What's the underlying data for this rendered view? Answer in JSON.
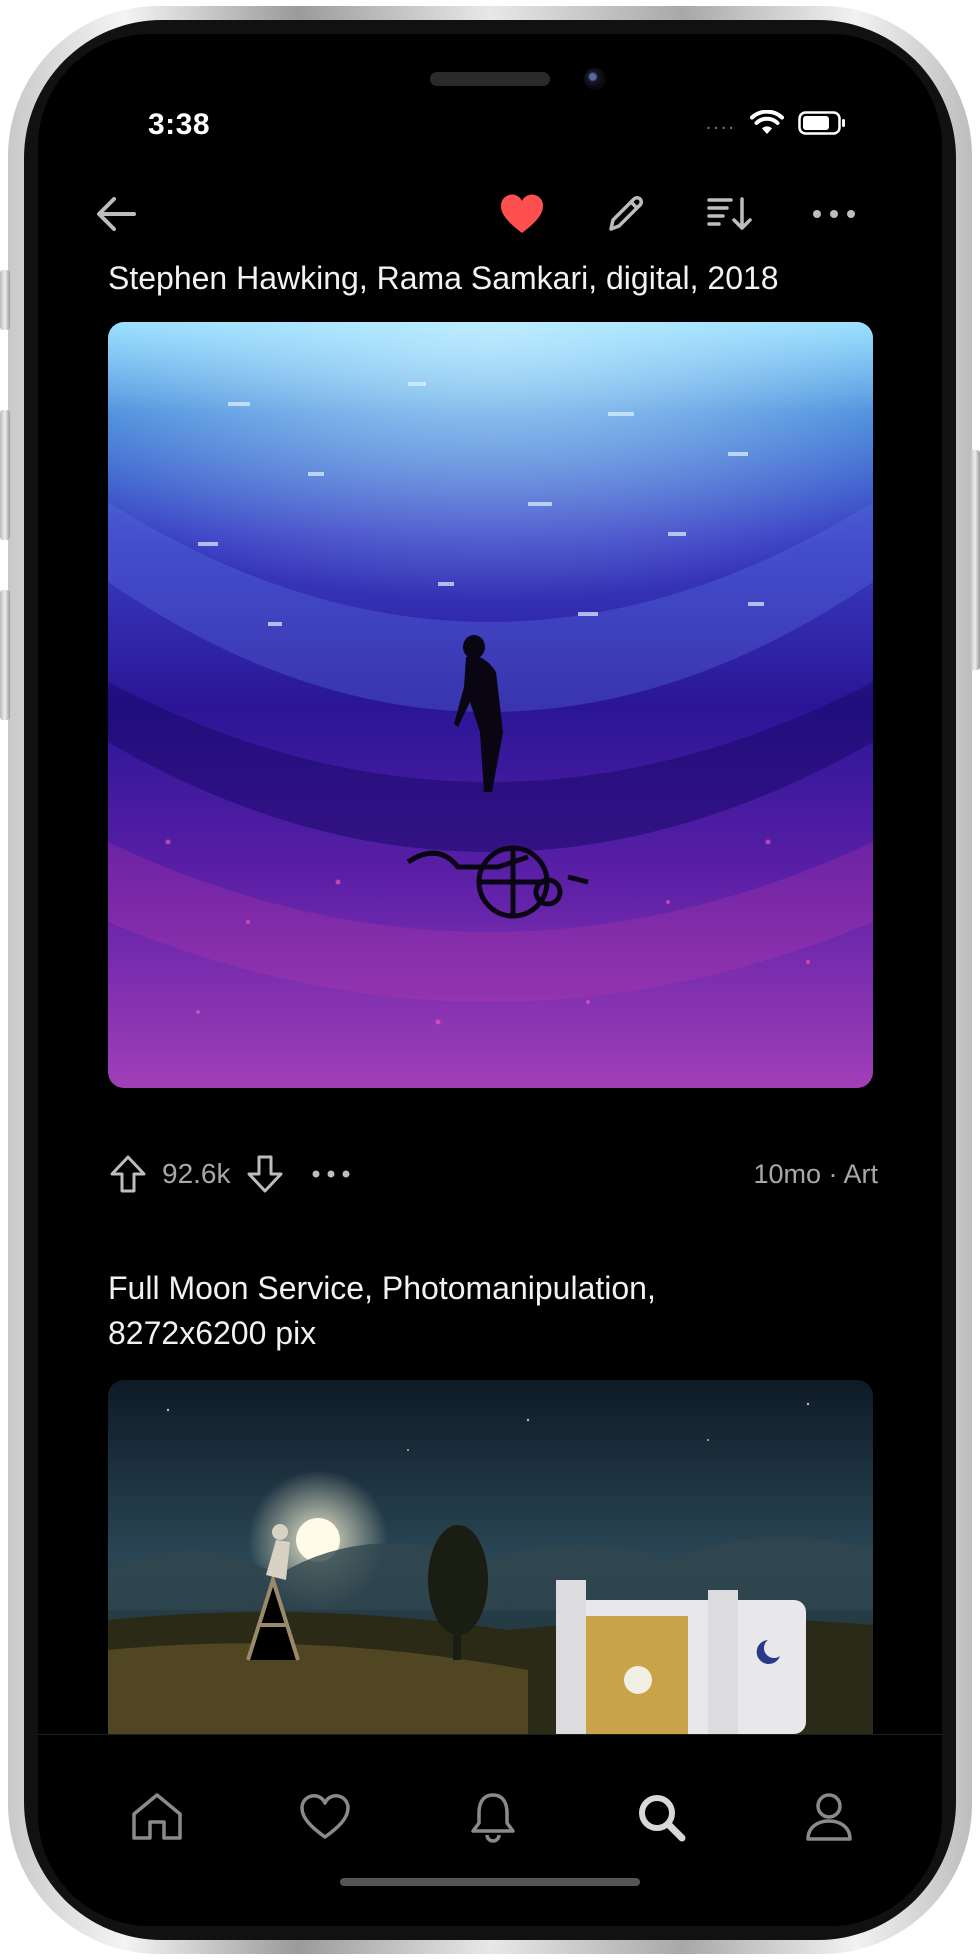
{
  "status_bar": {
    "time": "3:38",
    "signal": "...."
  },
  "toolbar": {
    "back_icon": "arrow-left-icon",
    "favorite_icon": "heart-icon",
    "edit_icon": "pencil-icon",
    "sort_icon": "sort-icon",
    "more_icon": "more-horizontal-icon",
    "accent": "#ff4f4f"
  },
  "posts": [
    {
      "title": "Stephen Hawking, Rama Samkari, digital, 2018",
      "score": "92.6k",
      "meta": "10mo · Art"
    },
    {
      "title": "Full Moon Service, Photomanipulation, 8272x6200 pix"
    }
  ],
  "bottom_nav": {
    "items": [
      {
        "name": "home",
        "icon": "home-icon"
      },
      {
        "name": "favorites",
        "icon": "heart-outline-icon"
      },
      {
        "name": "notifications",
        "icon": "bell-icon"
      },
      {
        "name": "search",
        "icon": "search-icon",
        "active": true
      },
      {
        "name": "profile",
        "icon": "user-icon"
      }
    ]
  },
  "colors": {
    "background": "#000000",
    "text": "#f2f2f2",
    "muted": "#a8a8a8"
  }
}
